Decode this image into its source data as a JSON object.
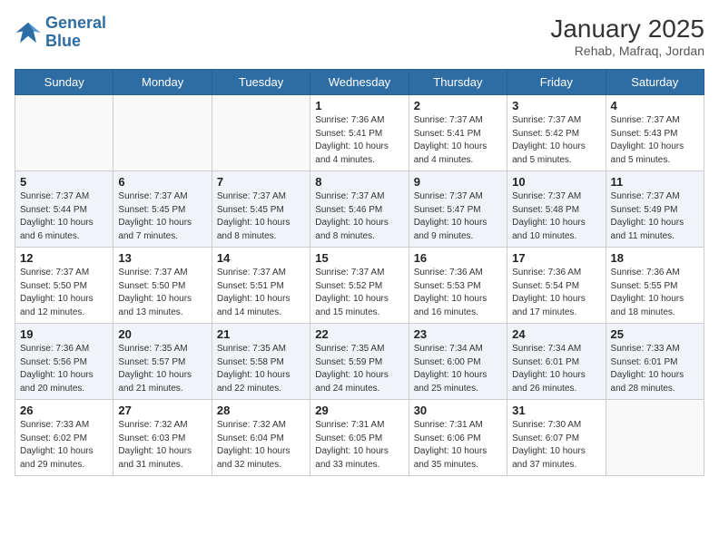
{
  "header": {
    "logo_line1": "General",
    "logo_line2": "Blue",
    "title": "January 2025",
    "subtitle": "Rehab, Mafraq, Jordan"
  },
  "days_of_week": [
    "Sunday",
    "Monday",
    "Tuesday",
    "Wednesday",
    "Thursday",
    "Friday",
    "Saturday"
  ],
  "weeks": [
    {
      "alt": false,
      "days": [
        {
          "num": "",
          "info": ""
        },
        {
          "num": "",
          "info": ""
        },
        {
          "num": "",
          "info": ""
        },
        {
          "num": "1",
          "info": "Sunrise: 7:36 AM\nSunset: 5:41 PM\nDaylight: 10 hours\nand 4 minutes."
        },
        {
          "num": "2",
          "info": "Sunrise: 7:37 AM\nSunset: 5:41 PM\nDaylight: 10 hours\nand 4 minutes."
        },
        {
          "num": "3",
          "info": "Sunrise: 7:37 AM\nSunset: 5:42 PM\nDaylight: 10 hours\nand 5 minutes."
        },
        {
          "num": "4",
          "info": "Sunrise: 7:37 AM\nSunset: 5:43 PM\nDaylight: 10 hours\nand 5 minutes."
        }
      ]
    },
    {
      "alt": true,
      "days": [
        {
          "num": "5",
          "info": "Sunrise: 7:37 AM\nSunset: 5:44 PM\nDaylight: 10 hours\nand 6 minutes."
        },
        {
          "num": "6",
          "info": "Sunrise: 7:37 AM\nSunset: 5:45 PM\nDaylight: 10 hours\nand 7 minutes."
        },
        {
          "num": "7",
          "info": "Sunrise: 7:37 AM\nSunset: 5:45 PM\nDaylight: 10 hours\nand 8 minutes."
        },
        {
          "num": "8",
          "info": "Sunrise: 7:37 AM\nSunset: 5:46 PM\nDaylight: 10 hours\nand 8 minutes."
        },
        {
          "num": "9",
          "info": "Sunrise: 7:37 AM\nSunset: 5:47 PM\nDaylight: 10 hours\nand 9 minutes."
        },
        {
          "num": "10",
          "info": "Sunrise: 7:37 AM\nSunset: 5:48 PM\nDaylight: 10 hours\nand 10 minutes."
        },
        {
          "num": "11",
          "info": "Sunrise: 7:37 AM\nSunset: 5:49 PM\nDaylight: 10 hours\nand 11 minutes."
        }
      ]
    },
    {
      "alt": false,
      "days": [
        {
          "num": "12",
          "info": "Sunrise: 7:37 AM\nSunset: 5:50 PM\nDaylight: 10 hours\nand 12 minutes."
        },
        {
          "num": "13",
          "info": "Sunrise: 7:37 AM\nSunset: 5:50 PM\nDaylight: 10 hours\nand 13 minutes."
        },
        {
          "num": "14",
          "info": "Sunrise: 7:37 AM\nSunset: 5:51 PM\nDaylight: 10 hours\nand 14 minutes."
        },
        {
          "num": "15",
          "info": "Sunrise: 7:37 AM\nSunset: 5:52 PM\nDaylight: 10 hours\nand 15 minutes."
        },
        {
          "num": "16",
          "info": "Sunrise: 7:36 AM\nSunset: 5:53 PM\nDaylight: 10 hours\nand 16 minutes."
        },
        {
          "num": "17",
          "info": "Sunrise: 7:36 AM\nSunset: 5:54 PM\nDaylight: 10 hours\nand 17 minutes."
        },
        {
          "num": "18",
          "info": "Sunrise: 7:36 AM\nSunset: 5:55 PM\nDaylight: 10 hours\nand 18 minutes."
        }
      ]
    },
    {
      "alt": true,
      "days": [
        {
          "num": "19",
          "info": "Sunrise: 7:36 AM\nSunset: 5:56 PM\nDaylight: 10 hours\nand 20 minutes."
        },
        {
          "num": "20",
          "info": "Sunrise: 7:35 AM\nSunset: 5:57 PM\nDaylight: 10 hours\nand 21 minutes."
        },
        {
          "num": "21",
          "info": "Sunrise: 7:35 AM\nSunset: 5:58 PM\nDaylight: 10 hours\nand 22 minutes."
        },
        {
          "num": "22",
          "info": "Sunrise: 7:35 AM\nSunset: 5:59 PM\nDaylight: 10 hours\nand 24 minutes."
        },
        {
          "num": "23",
          "info": "Sunrise: 7:34 AM\nSunset: 6:00 PM\nDaylight: 10 hours\nand 25 minutes."
        },
        {
          "num": "24",
          "info": "Sunrise: 7:34 AM\nSunset: 6:01 PM\nDaylight: 10 hours\nand 26 minutes."
        },
        {
          "num": "25",
          "info": "Sunrise: 7:33 AM\nSunset: 6:01 PM\nDaylight: 10 hours\nand 28 minutes."
        }
      ]
    },
    {
      "alt": false,
      "days": [
        {
          "num": "26",
          "info": "Sunrise: 7:33 AM\nSunset: 6:02 PM\nDaylight: 10 hours\nand 29 minutes."
        },
        {
          "num": "27",
          "info": "Sunrise: 7:32 AM\nSunset: 6:03 PM\nDaylight: 10 hours\nand 31 minutes."
        },
        {
          "num": "28",
          "info": "Sunrise: 7:32 AM\nSunset: 6:04 PM\nDaylight: 10 hours\nand 32 minutes."
        },
        {
          "num": "29",
          "info": "Sunrise: 7:31 AM\nSunset: 6:05 PM\nDaylight: 10 hours\nand 33 minutes."
        },
        {
          "num": "30",
          "info": "Sunrise: 7:31 AM\nSunset: 6:06 PM\nDaylight: 10 hours\nand 35 minutes."
        },
        {
          "num": "31",
          "info": "Sunrise: 7:30 AM\nSunset: 6:07 PM\nDaylight: 10 hours\nand 37 minutes."
        },
        {
          "num": "",
          "info": ""
        }
      ]
    }
  ]
}
